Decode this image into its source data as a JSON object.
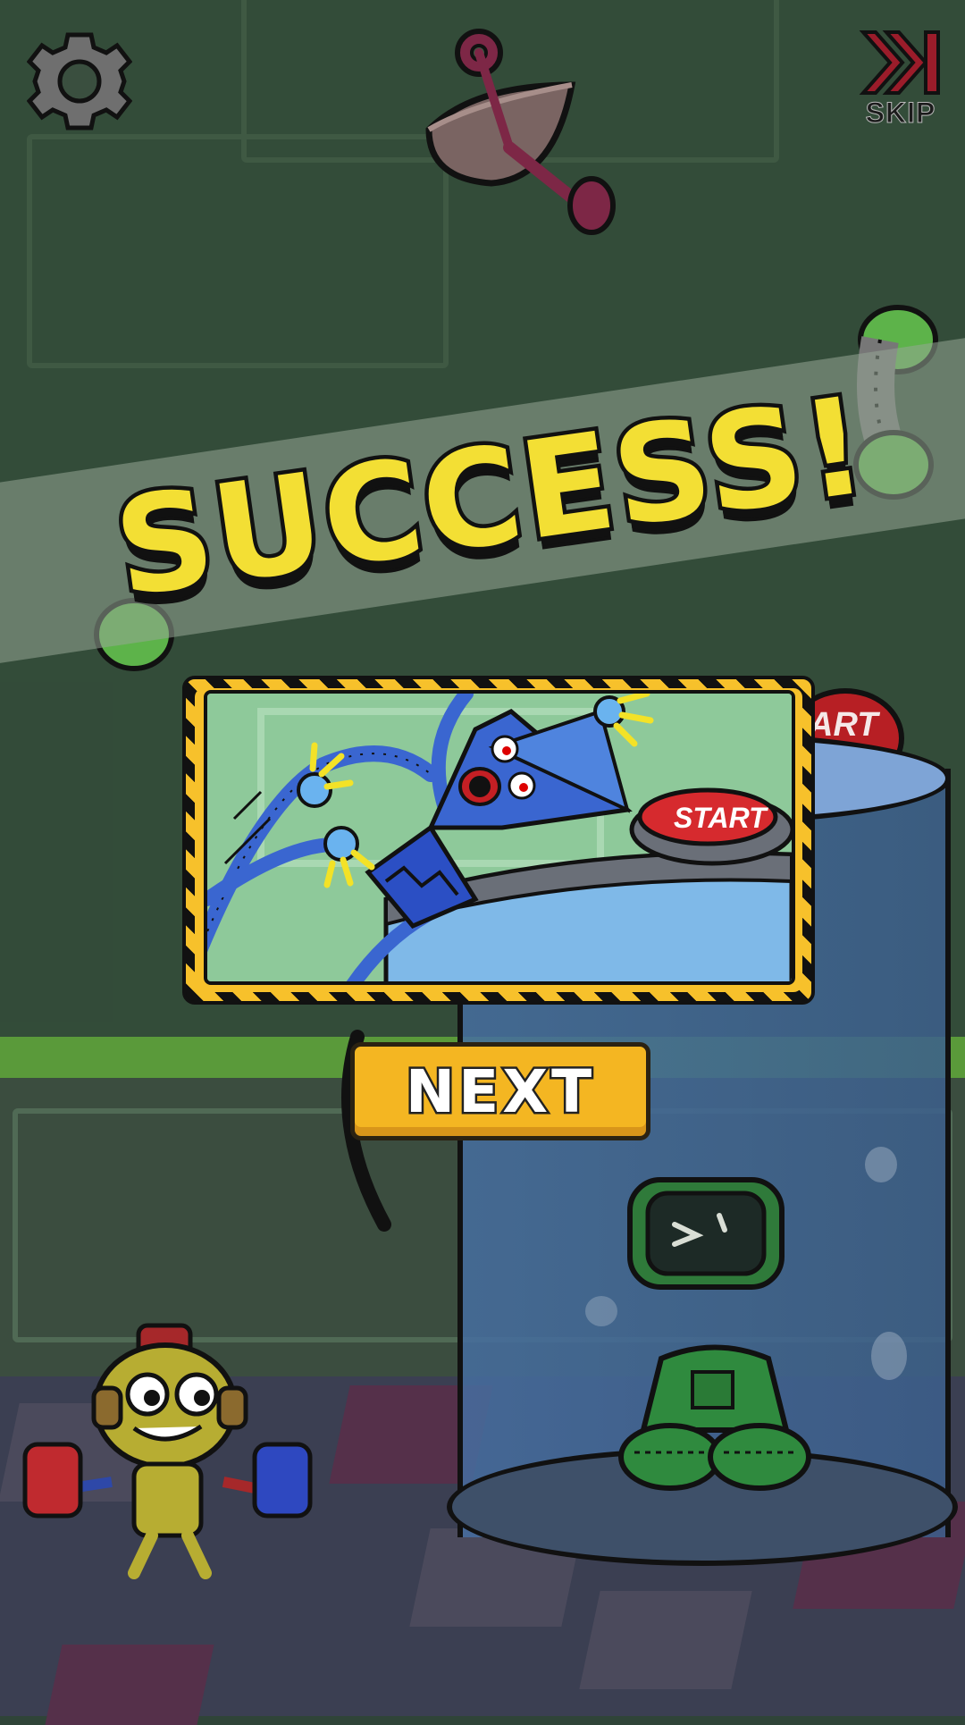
{
  "hud": {
    "settings_icon": "gear-icon",
    "skip_icon": "skip-forward-icon",
    "skip_label": "SKIP"
  },
  "result": {
    "title": "SUCCESS!",
    "next_label": "NEXT"
  },
  "scene": {
    "start_button_text": "ART",
    "card_start_button_text": "START"
  },
  "colors": {
    "title_yellow": "#f3df34",
    "button_orange": "#f4b622",
    "card_border": "#f7c12b",
    "skip_red": "#9b1c2a"
  }
}
